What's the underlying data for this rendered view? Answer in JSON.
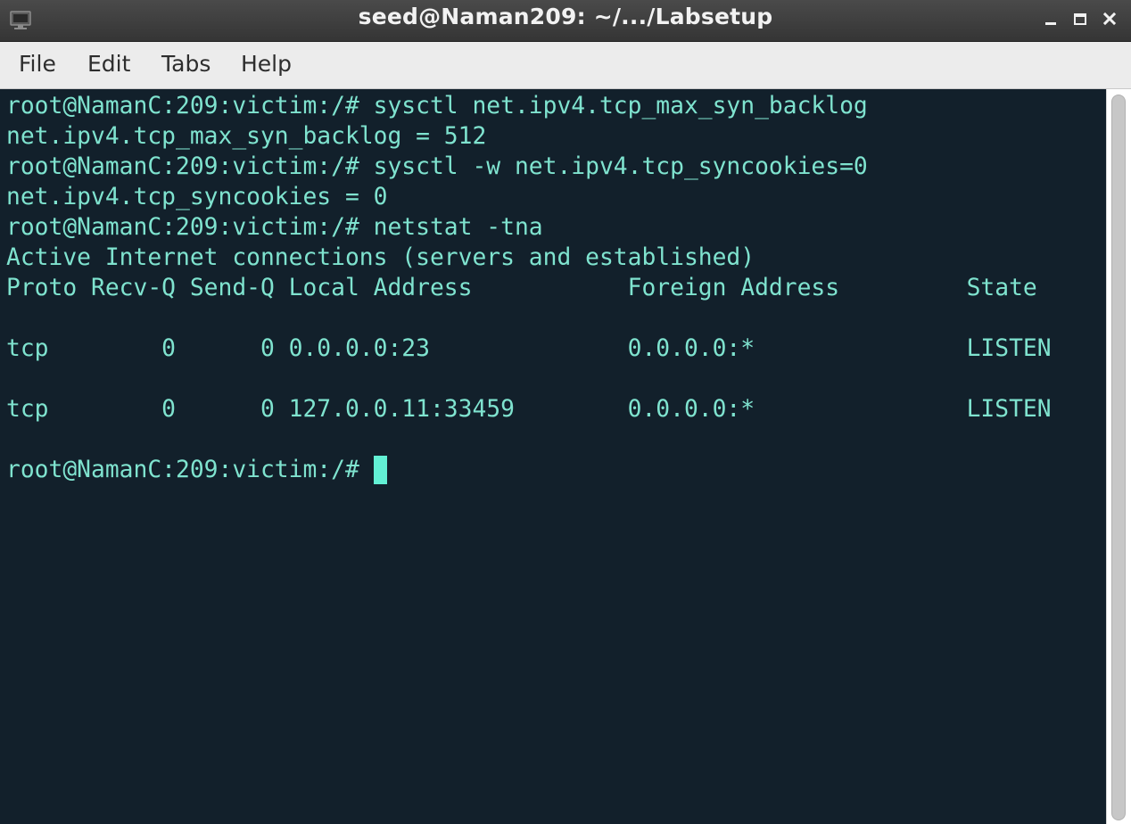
{
  "window": {
    "title": "seed@Naman209: ~/.../Labsetup"
  },
  "menubar": {
    "items": [
      "File",
      "Edit",
      "Tabs",
      "Help"
    ]
  },
  "terminal": {
    "lines": [
      "root@NamanC:209:victim:/# sysctl net.ipv4.tcp_max_syn_backlog",
      "net.ipv4.tcp_max_syn_backlog = 512",
      "root@NamanC:209:victim:/# sysctl -w net.ipv4.tcp_syncookies=0",
      "net.ipv4.tcp_syncookies = 0",
      "root@NamanC:209:victim:/# netstat -tna",
      "Active Internet connections (servers and established)",
      "Proto Recv-Q Send-Q Local Address           Foreign Address         State",
      "",
      "tcp        0      0 0.0.0.0:23              0.0.0.0:*               LISTEN",
      "",
      "tcp        0      0 127.0.0.11:33459        0.0.0.0:*               LISTEN",
      "",
      "root@NamanC:209:victim:/# "
    ]
  },
  "colors": {
    "terminal_bg": "#12202b",
    "terminal_fg": "#7fe3cf",
    "cursor": "#62f0d4",
    "titlebar": "#3d3d3d",
    "menubar": "#ececec"
  },
  "icons": {
    "app": "terminal-monitor-icon",
    "minimize": "minimize-icon",
    "maximize": "maximize-icon",
    "close": "close-icon"
  }
}
